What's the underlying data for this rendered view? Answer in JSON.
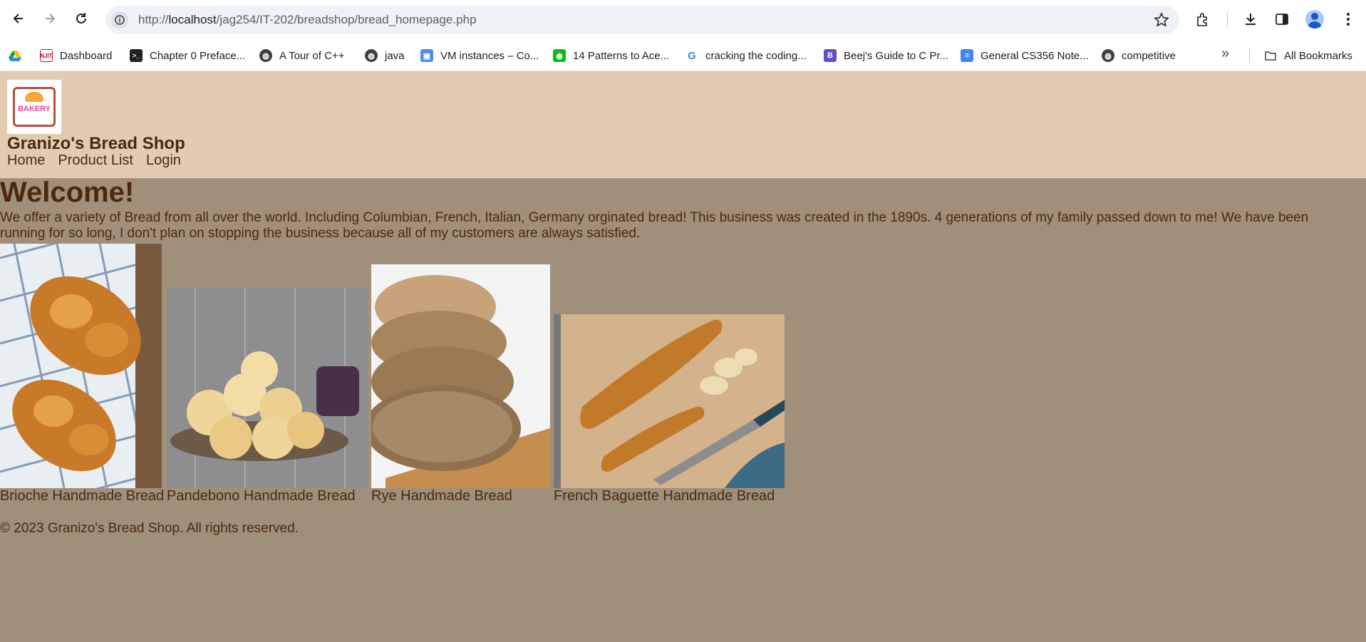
{
  "browser": {
    "url_prefix": "http://",
    "url_host": "localhost",
    "url_path": "/jag254/IT-202/breadshop/bread_homepage.php",
    "bookmarks": [
      {
        "label": "",
        "icon": "google-drive-icon"
      },
      {
        "label": "Dashboard",
        "icon": "njit-icon"
      },
      {
        "label": "Chapter 0 Preface...",
        "icon": "terminal-icon"
      },
      {
        "label": "A Tour of C++",
        "icon": "globe-icon"
      },
      {
        "label": "java",
        "icon": "globe-icon"
      },
      {
        "label": "VM instances – Co...",
        "icon": "cloud-compute-icon"
      },
      {
        "label": "14 Patterns to Ace...",
        "icon": "pattern-icon"
      },
      {
        "label": "cracking the coding...",
        "icon": "google-icon"
      },
      {
        "label": "Beej's Guide to C Pr...",
        "icon": "beej-icon"
      },
      {
        "label": "General CS356 Note...",
        "icon": "docs-icon"
      },
      {
        "label": "competitive",
        "icon": "globe-icon"
      }
    ],
    "all_bookmarks_label": "All Bookmarks"
  },
  "site": {
    "logo_text": "BAKERY",
    "name": "Granizo's Bread Shop",
    "nav": [
      "Home",
      "Product List",
      "Login"
    ]
  },
  "main": {
    "heading": "Welcome!",
    "intro": "We offer a variety of Bread from all over the world. Including Columbian, French, Italian, Germany orginated bread! This business was created in the 1890s. 4 generations of my family passed down to me! We have been running for so long, I don't plan on stopping the business because all of my customers are always satisfied.",
    "products": [
      {
        "caption": "Brioche Handmade Bread"
      },
      {
        "caption": "Pandebono Handmade Bread"
      },
      {
        "caption": "Rye Handmade Bread"
      },
      {
        "caption": "French Baguette Handmade Bread"
      }
    ]
  },
  "footer": {
    "copyright": "© 2023 Granizo's Bread Shop. All rights reserved."
  }
}
